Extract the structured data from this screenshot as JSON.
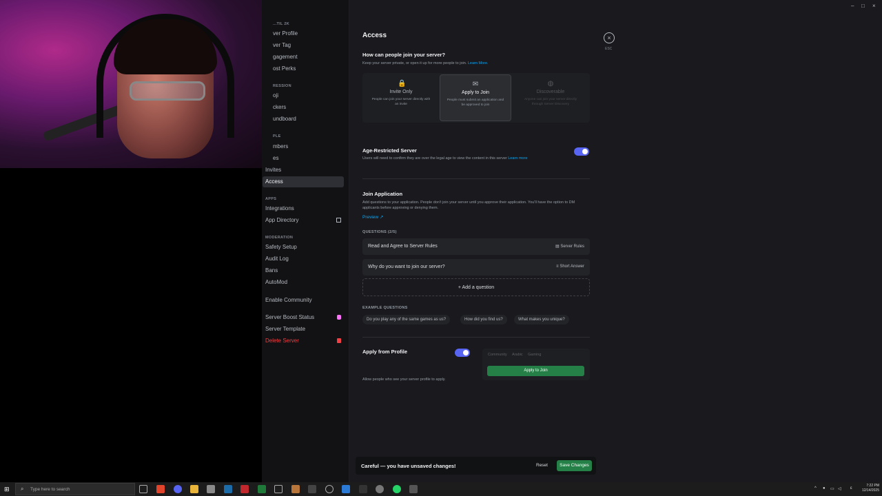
{
  "window": {
    "minimize": "–",
    "maximize": "□",
    "close": "×"
  },
  "sidebar": {
    "partial_items": [
      "ver Profile",
      "ver Tag",
      "gagement",
      "ost Perks"
    ],
    "partial_heads": [
      "...TIL 2K",
      "RESSION",
      "PLE"
    ],
    "partial_items_2": [
      "oji",
      "ckers",
      "undboard",
      "mbers",
      "es"
    ],
    "invites": "Invites",
    "access": "Access",
    "apps_head": "APPS",
    "integrations": "Integrations",
    "app_directory": "App Directory",
    "moderation_head": "MODERATION",
    "safety_setup": "Safety Setup",
    "audit_log": "Audit Log",
    "bans": "Bans",
    "automod": "AutoMod",
    "enable_community": "Enable Community",
    "server_boost_status": "Server Boost Status",
    "server_template": "Server Template",
    "delete_server": "Delete Server"
  },
  "main": {
    "title": "Access",
    "esc": "×",
    "esc_label": "ESC",
    "join_heading": "How can people join your server?",
    "join_desc": "Keep your server private, or open it up for more people to join.",
    "learn_more": "Learn More.",
    "options": [
      {
        "icon": "🔒",
        "name": "Invite Only",
        "desc": "People can join your server directly with an invite"
      },
      {
        "icon": "✉",
        "name": "Apply to Join",
        "desc": "People must submit an application and be approved to join"
      },
      {
        "icon": "◍",
        "name": "Discoverable",
        "desc": "Anyone can join your server directly through Server Discovery"
      }
    ],
    "age_heading": "Age-Restricted Server",
    "age_desc": "Users will need to confirm they are over the legal age to view the content in this server",
    "age_learn": "Learn more",
    "join_app_heading": "Join Application",
    "join_app_desc": "Add questions to your application. People don't join your server until you approve their application. You'll have the option to DM applicants before approving or denying them.",
    "preview": "Preview",
    "questions_label": "QUESTIONS (2/5)",
    "questions": [
      {
        "text": "Read and Agree to Server Rules",
        "type": "Server Rules",
        "type_icon": "▤"
      },
      {
        "text": "Why do you want to join our server?",
        "type": "Short Answer",
        "type_icon": "≡"
      }
    ],
    "add_question": "+ Add a question",
    "examples_label": "EXAMPLE QUESTIONS",
    "examples": [
      "Do you play any of the same games as us?",
      "How did you find us?",
      "What makes you unique?"
    ],
    "apply_profile_heading": "Apply from Profile",
    "apply_profile_desc": "Allow people who see your server profile to apply.",
    "preview_tags": "Community Arabic Gaming",
    "apply_button": "Apply to Join"
  },
  "unsaved": {
    "message": "Careful — you have unsaved changes!",
    "reset": "Reset",
    "save": "Save Changes"
  },
  "taskbar": {
    "search_placeholder": "Type here to search",
    "time": "7:22 PM",
    "date": "12/14/2025"
  }
}
